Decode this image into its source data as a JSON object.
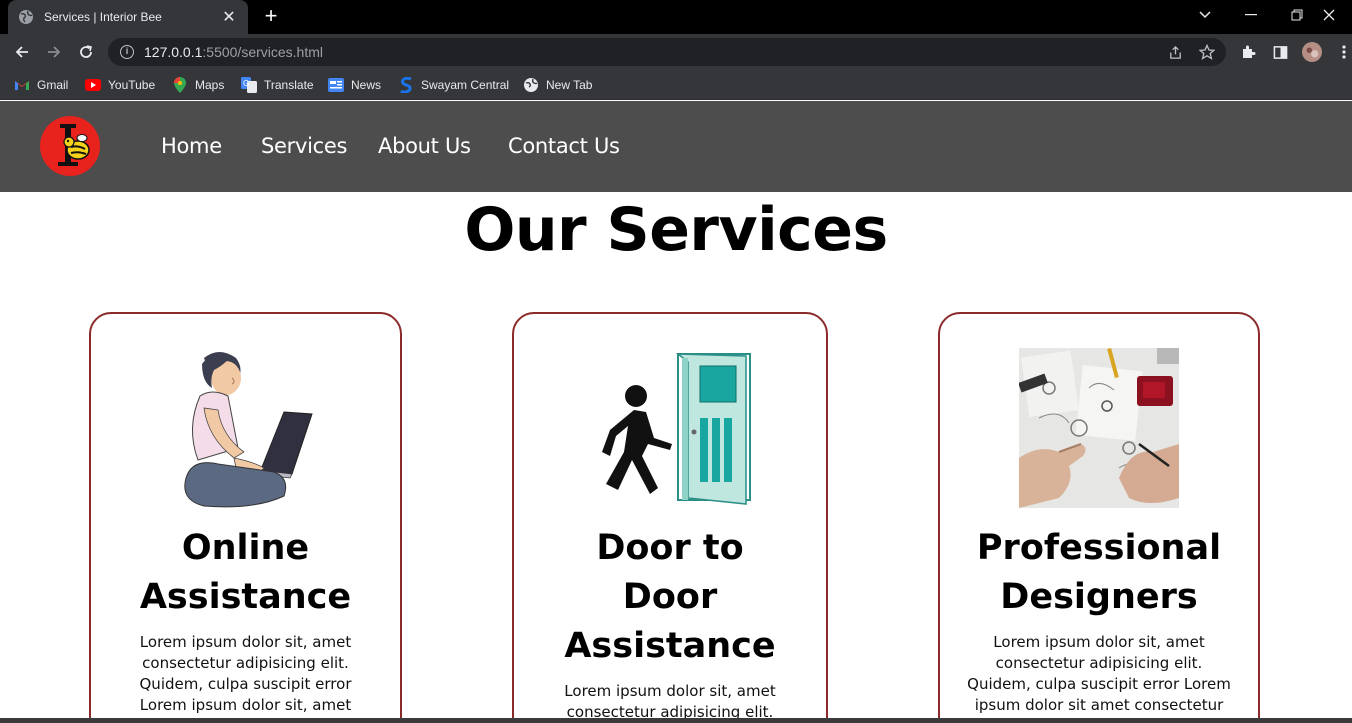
{
  "browser": {
    "tab_title": "Services | Interior Bee",
    "tab_close": "✕",
    "new_tab": "+",
    "url_host": "127.0.0.1",
    "url_rest": ":5500/services.html",
    "window_controls": [
      "minimize-icon",
      "restore-icon",
      "close-icon"
    ],
    "bookmarks": [
      {
        "label": "Gmail",
        "icon": "gmail-icon"
      },
      {
        "label": "YouTube",
        "icon": "youtube-icon"
      },
      {
        "label": "Maps",
        "icon": "maps-icon"
      },
      {
        "label": "Translate",
        "icon": "translate-icon"
      },
      {
        "label": "News",
        "icon": "news-icon"
      },
      {
        "label": "Swayam Central",
        "icon": "swayam-icon"
      },
      {
        "label": "New Tab",
        "icon": "new-tab-icon"
      }
    ]
  },
  "site": {
    "nav": [
      "Home",
      "Services",
      "About Us",
      "Contact Us"
    ],
    "title": "Our Services",
    "cards": [
      {
        "title_lines": [
          "Online",
          "Assistance"
        ],
        "text_lines": [
          "Lorem ipsum dolor sit, amet",
          "consectetur adipisicing elit.",
          "Quidem, culpa suscipit error",
          "Lorem ipsum dolor sit, amet"
        ],
        "image": "person-with-laptop-illustration"
      },
      {
        "title_lines": [
          "Door to",
          "Door",
          "Assistance"
        ],
        "text_lines": [
          "Lorem ipsum dolor sit, amet",
          "consectetur adipisicing elit."
        ],
        "image": "person-walking-through-door-illustration"
      },
      {
        "title_lines": [
          "Professional",
          "Designers"
        ],
        "text_lines": [
          "Lorem ipsum dolor sit, amet",
          "consectetur adipisicing elit.",
          "Quidem, culpa suscipit error Lorem",
          "ipsum dolor sit amet consectetur"
        ],
        "image": "designer-sketching-photo"
      }
    ]
  },
  "colors": {
    "nav_bg": "#4d4d4d",
    "card_border": "#8b2a2a",
    "logo_bg": "#e8221c"
  }
}
